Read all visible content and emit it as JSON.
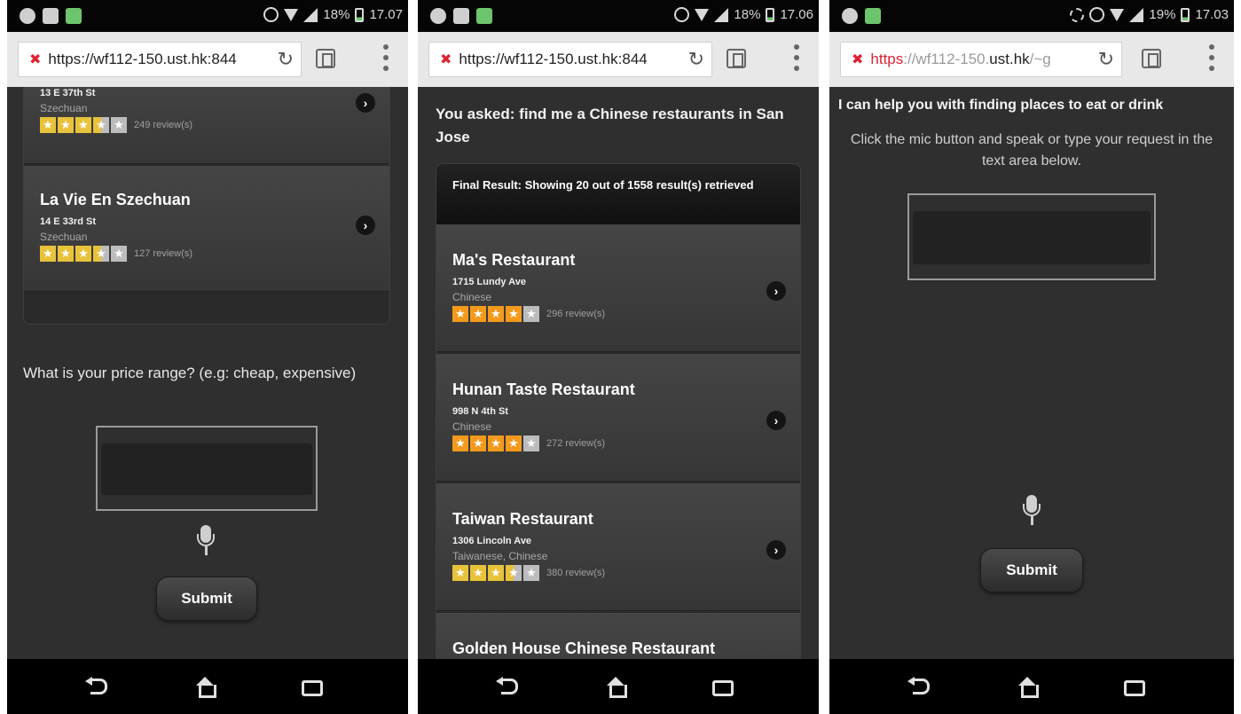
{
  "screens": [
    {
      "status": {
        "battery": "18%",
        "time": "17.07"
      },
      "browser": {
        "url": "https://wf112-150.ust.hk:844"
      },
      "results": [
        {
          "name": "",
          "address": "13 E 37th St",
          "category": "Szechuan",
          "stars": 3.5,
          "reviews": "249 review(s)"
        },
        {
          "name": "La Vie En Szechuan",
          "address": "14 E 33rd St",
          "category": "Szechuan",
          "stars": 3.5,
          "reviews": "127 review(s)"
        }
      ],
      "prompt": "What is your price range? (e.g: cheap, expensive)",
      "submit_label": "Submit"
    },
    {
      "status": {
        "battery": "18%",
        "time": "17.06"
      },
      "browser": {
        "url": "https://wf112-150.ust.hk:844"
      },
      "asked": "You asked: find me a Chinese restaurants in San Jose",
      "result_header": "Final Result: Showing 20 out of 1558 result(s) retrieved",
      "results": [
        {
          "name": "Ma's Restaurant",
          "address": "1715 Lundy Ave",
          "category": "Chinese",
          "stars": 4,
          "reviews": "296 review(s)"
        },
        {
          "name": "Hunan Taste Restaurant",
          "address": "998 N 4th St",
          "category": "Chinese",
          "stars": 4,
          "reviews": "272 review(s)"
        },
        {
          "name": "Taiwan Restaurant",
          "address": "1306 Lincoln Ave",
          "category": "Taiwanese, Chinese",
          "stars": 3.5,
          "reviews": "380 review(s)"
        },
        {
          "name": "Golden House Chinese Restaurant",
          "address": "",
          "category": "",
          "stars": 0,
          "reviews": ""
        }
      ]
    },
    {
      "status": {
        "battery": "19%",
        "time": "17.03"
      },
      "browser": {
        "url_scheme": "https",
        "url_rest_faded": "://wf112-150.",
        "url_host": "ust.hk",
        "url_tail_faded": "/~g"
      },
      "help_title": "I can help you with finding places to eat or drink",
      "help_sub": "Click the mic button and speak or type your request in the text area below.",
      "submit_label": "Submit"
    }
  ],
  "colors": {
    "background": "#2f2f2f",
    "star_orange": "#f39a1c",
    "star_yellow": "#e8c23a",
    "url_error": "#dd2233"
  }
}
